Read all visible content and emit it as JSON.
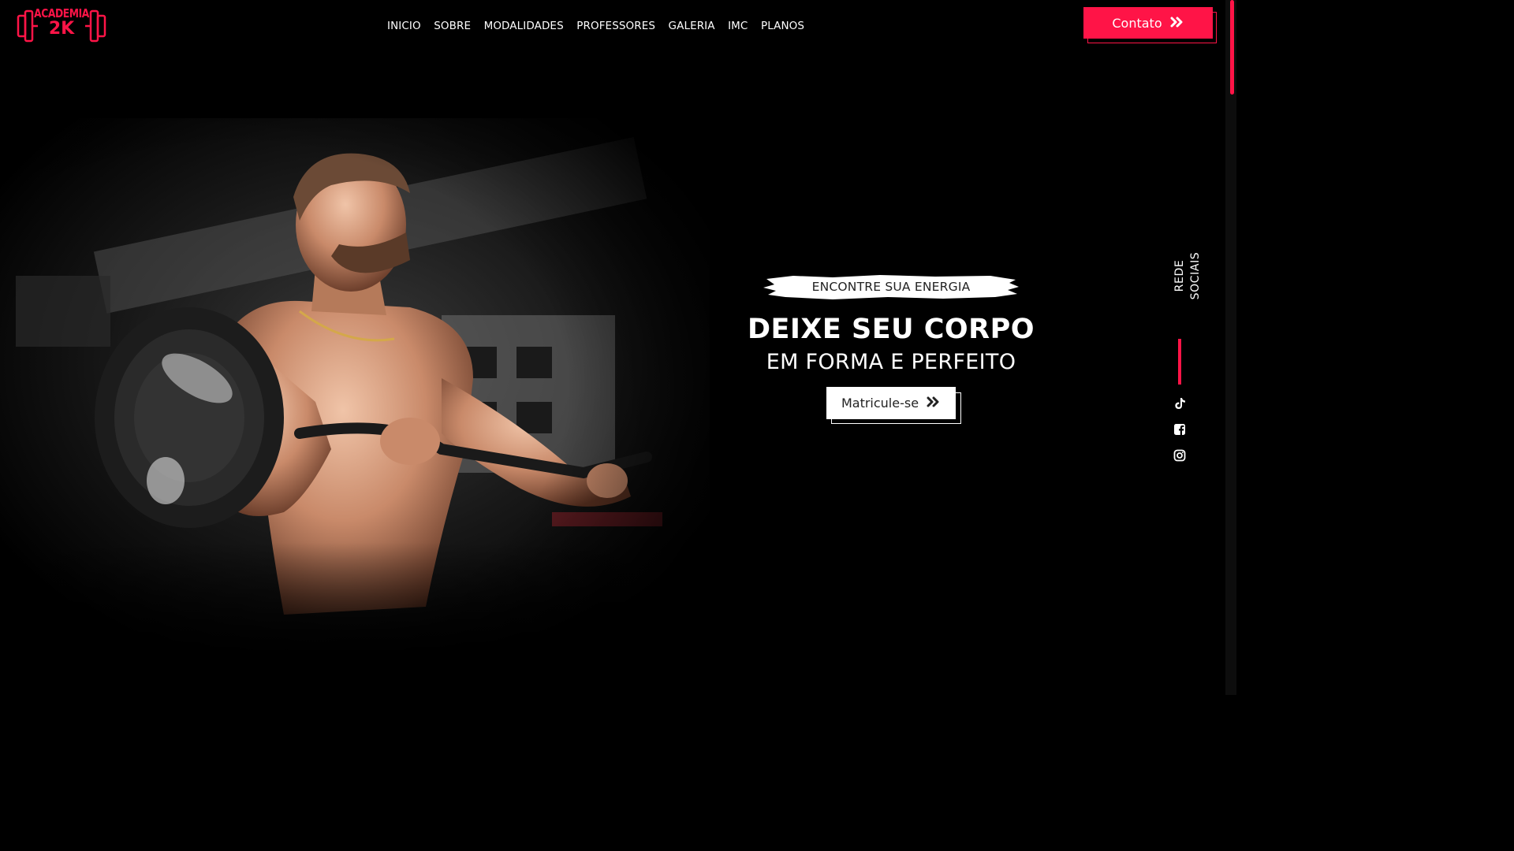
{
  "brand": {
    "logo_line1": "ACADEMIA",
    "logo_line2": "2K",
    "accent_color": "#ff1447"
  },
  "nav": {
    "items": [
      {
        "label": "INICIO"
      },
      {
        "label": "SOBRE"
      },
      {
        "label": "MODALIDADES"
      },
      {
        "label": "PROFESSORES"
      },
      {
        "label": "GALERIA"
      },
      {
        "label": "IMC"
      },
      {
        "label": "PLANOS"
      }
    ]
  },
  "header": {
    "contact_label": "Contato",
    "contact_icon": "double-chevron-right-icon"
  },
  "hero": {
    "tagline": "ENCONTRE SUA ENERGIA",
    "headline": "DEIXE SEU CORPO",
    "subheadline": "EM FORMA E PERFEITO",
    "cta_label": "Matricule-se",
    "cta_icon": "double-chevron-right-icon",
    "image_subject": "man lifting barbell in gym"
  },
  "social": {
    "label": "REDE SOCIAIS",
    "icons": [
      "tiktok-icon",
      "facebook-icon",
      "instagram-icon"
    ]
  }
}
